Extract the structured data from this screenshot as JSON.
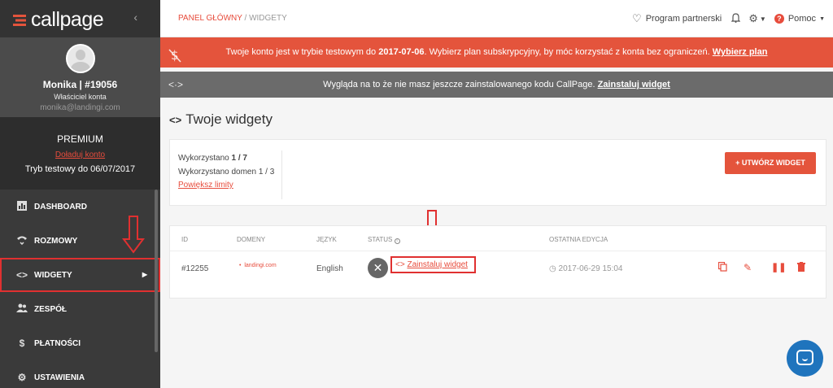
{
  "brand": {
    "logo_text": "callpage",
    "collapse_icon": "chevron-left-icon",
    "accent": "#e4543c"
  },
  "profile": {
    "name": "Monika | #19056",
    "role": "Właściciel konta",
    "email": "monika@landingi.com"
  },
  "plan": {
    "name": "PREMIUM",
    "topup_link": "Doładuj konto",
    "trial": "Tryb testowy do 06/07/2017"
  },
  "nav": {
    "items": [
      {
        "label": "DASHBOARD",
        "icon": "bar-chart-icon"
      },
      {
        "label": "ROZMOWY",
        "icon": "calls-icon"
      },
      {
        "label": "WIDGETY",
        "icon": "code-icon"
      },
      {
        "label": "ZESPÓŁ",
        "icon": "team-icon"
      },
      {
        "label": "PŁATNOŚCI",
        "icon": "dollar-icon"
      },
      {
        "label": "USTAWIENIA",
        "icon": "gear-icon"
      }
    ]
  },
  "breadcrumb": {
    "home": "PANEL GŁÓWNY",
    "sep": "/",
    "current": "WIDGETY"
  },
  "header": {
    "partner": "Program partnerski",
    "help": "Pomoc"
  },
  "banner_trial": {
    "text1": "Twoje konto jest w trybie testowym do ",
    "date": "2017-07-06",
    "text2": ". Wybierz plan subskrypcyjny, by móc korzystać z konta bez ograniczeń. ",
    "link": "Wybierz plan"
  },
  "banner_install": {
    "text": "Wygląda na to że nie masz jeszcze zainstalowanego kodu CallPage. ",
    "link": "Zainstaluj widget"
  },
  "page": {
    "title": "Twoje widgety",
    "title_icon": "code-icon"
  },
  "stats": {
    "used_label": "Wykorzystano ",
    "used_value": "1 / 7",
    "domains": "Wykorzystano domen 1 / 3",
    "increase": "Powiększ limity",
    "create_button": "+ UTWÓRZ WIDGET"
  },
  "table": {
    "headers": [
      "ID",
      "DOMENY",
      "JĘZYK",
      "STATUS",
      "OSTATNIA EDYCJA"
    ],
    "rows": [
      {
        "id": "#12255",
        "domain": "landingi.com",
        "language": "English",
        "status_action": "Zainstaluj widget",
        "edited": "2017-06-29 15:04"
      }
    ]
  }
}
